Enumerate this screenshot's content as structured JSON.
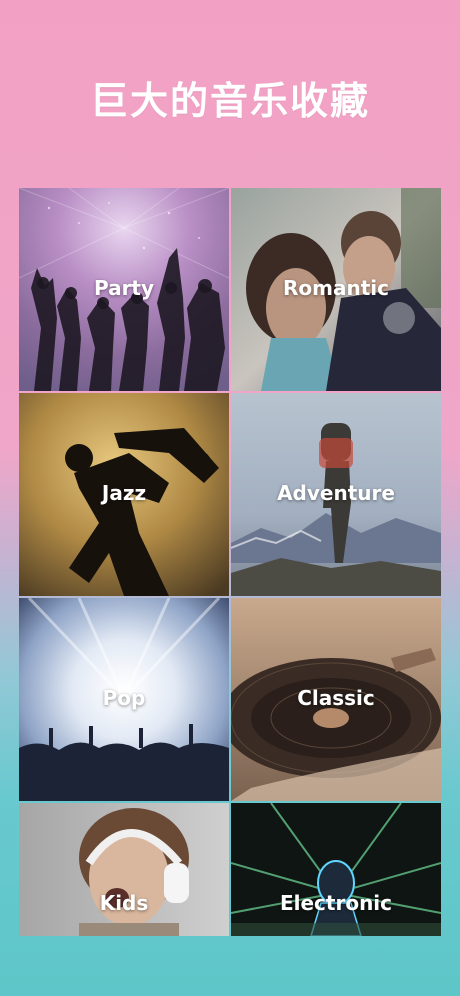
{
  "header": {
    "title": "巨大的音乐收藏"
  },
  "categories": [
    {
      "label": "Party",
      "icon": "party-image"
    },
    {
      "label": "Romantic",
      "icon": "romantic-image"
    },
    {
      "label": "Jazz",
      "icon": "jazz-image"
    },
    {
      "label": "Adventure",
      "icon": "adventure-image"
    },
    {
      "label": "Pop",
      "icon": "pop-image"
    },
    {
      "label": "Classic",
      "icon": "classic-image"
    },
    {
      "label": "Kids",
      "icon": "kids-image"
    },
    {
      "label": "Electronic",
      "icon": "electronic-image"
    }
  ],
  "colors": {
    "top_background": "#f2a1c4",
    "bottom_background": "#5ec6c8",
    "text": "#ffffff"
  }
}
